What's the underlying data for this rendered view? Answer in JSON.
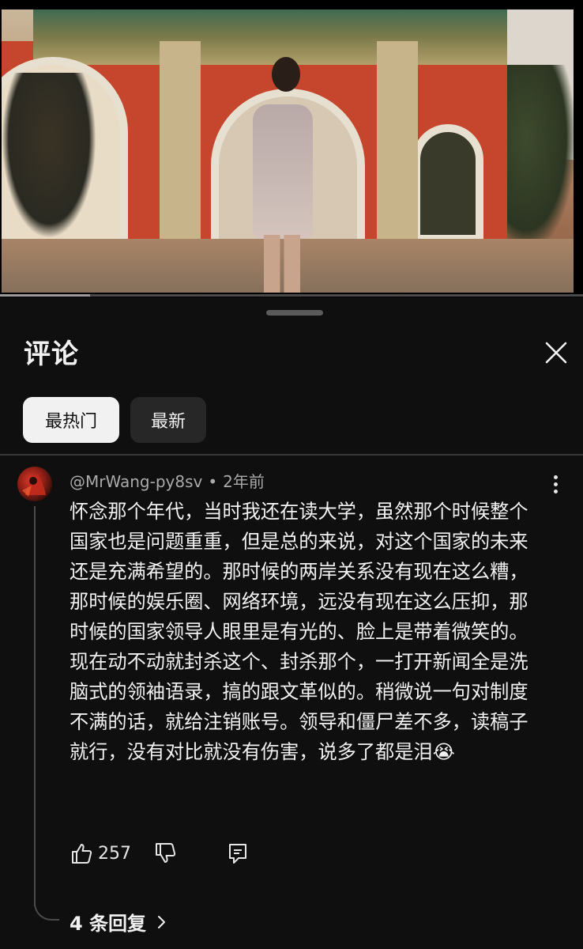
{
  "video": {
    "progress_fraction": 0.155
  },
  "sheet": {
    "title": "评论",
    "close_icon": "close-icon"
  },
  "filters": {
    "top_label": "最热门",
    "newest_label": "最新"
  },
  "comment": {
    "author": "@MrWang-py8sv",
    "separator": "•",
    "time": "2年前",
    "text": "怀念那个年代，当时我还在读大学，虽然那个时候整个国家也是问题重重，但是总的来说，对这个国家的未来还是充满希望的。那时候的两岸关系没有现在这么糟，那时候的娱乐圈、网络环境，远没有现在这么压抑，那时候的国家领导人眼里是有光的、脸上是带着微笑的。现在动不动就封杀这个、封杀那个，一打开新闻全是洗脑式的领袖语录，搞的跟文革似的。稍微说一句对制度不满的话，就给注销账号。领导和僵尸差不多，读稿子就行，没有对比就没有伤害，说多了都是泪😭",
    "likes": "257",
    "replies_label": "4 条回复",
    "icons": [
      "thumbs-up-icon",
      "thumbs-down-icon",
      "reply-icon",
      "more-vert-icon",
      "chevron-right-icon"
    ]
  }
}
